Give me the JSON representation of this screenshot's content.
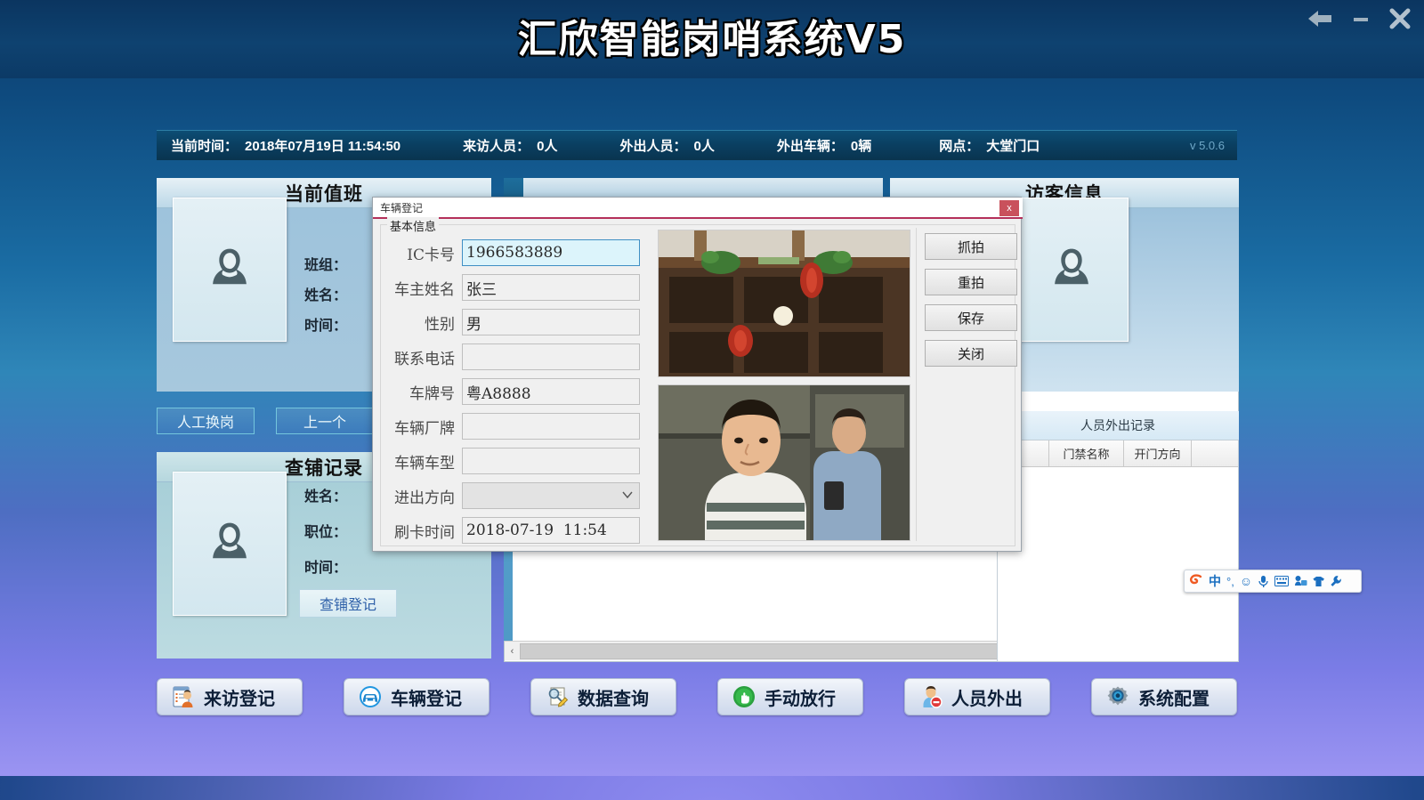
{
  "window": {
    "title": "汇欣智能岗哨系统V5",
    "controls": [
      {
        "name": "back-button",
        "glyph": "←"
      },
      {
        "name": "minimize-button",
        "glyph": "—"
      },
      {
        "name": "close-button",
        "glyph": "✕"
      }
    ]
  },
  "statusbar": {
    "items": [
      {
        "label": "当前时间：",
        "value": "2018年07月19日 11:54:50"
      },
      {
        "label": "来访人员：",
        "value": "0人"
      },
      {
        "label": "外出人员：",
        "value": "0人"
      },
      {
        "label": "外出车辆：",
        "value": "0辆"
      },
      {
        "label": "网点：",
        "value": "大堂门口"
      }
    ],
    "version": "v 5.0.6"
  },
  "duty_panel": {
    "title": "当前值班",
    "fields": [
      {
        "label": "班组：",
        "value": ""
      },
      {
        "label": "姓名：",
        "value": ""
      },
      {
        "label": "时间：",
        "value": ""
      }
    ],
    "buttons": [
      {
        "name": "manual-shift-button",
        "label": "人工换岗"
      },
      {
        "name": "previous-button",
        "label": "上一个"
      }
    ]
  },
  "check_panel": {
    "title": "查铺记录",
    "fields": [
      {
        "label": "姓名：",
        "value": ""
      },
      {
        "label": "职位：",
        "value": ""
      },
      {
        "label": "时间：",
        "value": ""
      }
    ],
    "button": {
      "name": "check-register-button",
      "label": "查铺登记"
    }
  },
  "visitor_panel": {
    "title": "访客信息"
  },
  "out_records": {
    "title": "人员外出记录",
    "columns": [
      "",
      "门禁名称",
      "开门方向",
      ""
    ],
    "rows": []
  },
  "center_panel": {
    "scrollbar": {
      "left_arrow": "‹",
      "right_arrow": "›"
    }
  },
  "dialog": {
    "title": "车辆登记",
    "close_label": "x",
    "group_legend": "基本信息",
    "fields": [
      {
        "name": "ic-card-field",
        "label": "IC卡号",
        "value": "1966583889",
        "type": "text",
        "focused": true
      },
      {
        "name": "owner-name-field",
        "label": "车主姓名",
        "value": "张三",
        "type": "text",
        "focused": false
      },
      {
        "name": "gender-field",
        "label": "性别",
        "value": "男",
        "type": "text",
        "focused": false
      },
      {
        "name": "phone-field",
        "label": "联系电话",
        "value": "",
        "type": "text",
        "focused": false
      },
      {
        "name": "plate-number-field",
        "label": "车牌号",
        "value": "粤A8888",
        "type": "text",
        "focused": false
      },
      {
        "name": "vehicle-brand-field",
        "label": "车辆厂牌",
        "value": "",
        "type": "text",
        "focused": false
      },
      {
        "name": "vehicle-model-field",
        "label": "车辆车型",
        "value": "",
        "type": "text",
        "focused": false
      },
      {
        "name": "direction-select",
        "label": "进出方向",
        "value": "",
        "type": "select",
        "focused": false
      },
      {
        "name": "swipe-time-field",
        "label": "刷卡时间",
        "value": "2018-07-19  11:54",
        "type": "text",
        "focused": false
      }
    ],
    "buttons": [
      {
        "name": "capture-button",
        "label": "抓拍"
      },
      {
        "name": "recapture-button",
        "label": "重拍"
      },
      {
        "name": "save-button",
        "label": "保存"
      },
      {
        "name": "close-dialog-button",
        "label": "关闭"
      }
    ],
    "images": [
      {
        "name": "scene-capture-image",
        "alt": "室内场景抓拍"
      },
      {
        "name": "person-capture-image",
        "alt": "人员抓拍"
      }
    ]
  },
  "toolbar": {
    "buttons": [
      {
        "name": "visitor-register-button",
        "label": "来访登记",
        "icon": "visitor-register-icon"
      },
      {
        "name": "vehicle-register-button",
        "label": "车辆登记",
        "icon": "car-icon"
      },
      {
        "name": "data-query-button",
        "label": "数据查询",
        "icon": "magnifier-icon"
      },
      {
        "name": "manual-release-button",
        "label": "手动放行",
        "icon": "hand-green-icon"
      },
      {
        "name": "personnel-out-button",
        "label": "人员外出",
        "icon": "person-out-icon"
      },
      {
        "name": "system-config-button",
        "label": "系统配置",
        "icon": "gear-icon"
      }
    ]
  },
  "ime": {
    "items": [
      {
        "name": "sogou-logo-icon",
        "glyph": "S"
      },
      {
        "name": "chinese-mode-icon",
        "glyph": "中"
      },
      {
        "name": "punctuation-icon",
        "glyph": "°,"
      },
      {
        "name": "emoji-icon",
        "glyph": "☺"
      },
      {
        "name": "voice-input-icon",
        "glyph": "🎤"
      },
      {
        "name": "soft-keyboard-icon",
        "glyph": "▤"
      },
      {
        "name": "toolbox-icon",
        "glyph": "⚙"
      },
      {
        "name": "skin-icon",
        "glyph": "👕"
      },
      {
        "name": "settings-icon",
        "glyph": "🔧"
      }
    ]
  },
  "colors": {
    "accent_blue": "#1a6ca3",
    "dialog_accent": "#b4305a",
    "status_bg": "#0a3f61",
    "close_red": "#c9515c"
  }
}
